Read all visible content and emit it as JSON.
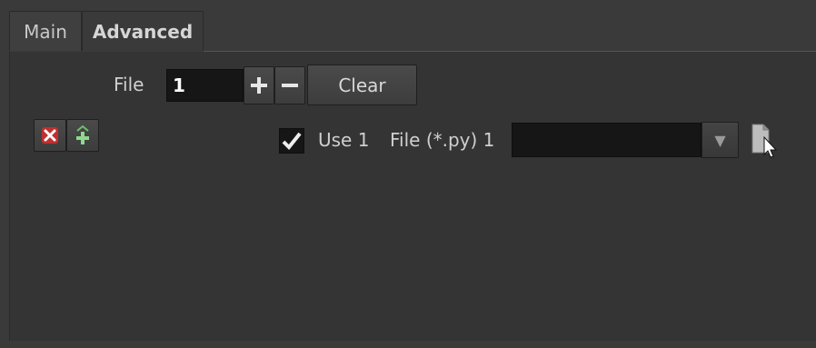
{
  "tabs": [
    {
      "label": "Main",
      "active": false
    },
    {
      "label": "Advanced",
      "active": true
    }
  ],
  "file_row": {
    "label": "File",
    "count_value": "1",
    "clear_label": "Clear"
  },
  "entry": {
    "use_checked": true,
    "use_label": "Use 1",
    "file_label": "File (*.py) 1",
    "file_value": ""
  },
  "icons": {
    "plus": "plus-icon",
    "minus": "minus-icon",
    "remove": "remove-x-icon",
    "insert": "insert-plus-icon",
    "dropdown": "chevron-down-icon",
    "browse": "file-browse-icon"
  }
}
